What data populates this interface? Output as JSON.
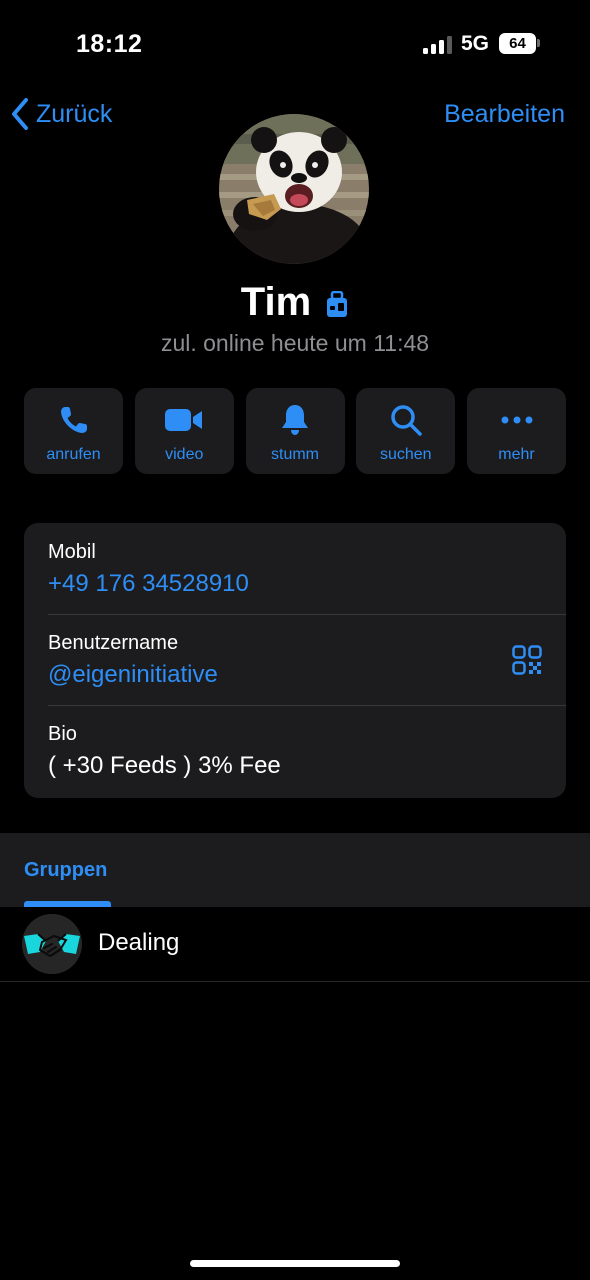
{
  "status_bar": {
    "time": "18:12",
    "network": "5G",
    "battery": "64"
  },
  "nav": {
    "back_label": "Zurück",
    "edit_label": "Bearbeiten"
  },
  "profile": {
    "name": "Tim",
    "last_seen": "zul. online heute um 11:48",
    "avatar_icon": "panda-photo"
  },
  "actions": [
    {
      "label": "anrufen",
      "icon": "phone-icon"
    },
    {
      "label": "video",
      "icon": "video-camera-icon"
    },
    {
      "label": "stumm",
      "icon": "bell-icon"
    },
    {
      "label": "suchen",
      "icon": "search-icon"
    },
    {
      "label": "mehr",
      "icon": "more-icon"
    }
  ],
  "info": {
    "mobile_label": "Mobil",
    "mobile_value": "+49 176 34528910",
    "username_label": "Benutzername",
    "username_value": "@eigeninitiative",
    "bio_label": "Bio",
    "bio_value": "( +30 Feeds ) 3% Fee"
  },
  "tabs": [
    {
      "label": "Gruppen"
    }
  ],
  "groups": [
    {
      "name": "Dealing",
      "icon": "handshake-icon"
    }
  ],
  "colors": {
    "accent": "#2e8ef5",
    "background": "#000000",
    "card": "#1c1c1e",
    "secondary_text": "#8e8e93"
  }
}
